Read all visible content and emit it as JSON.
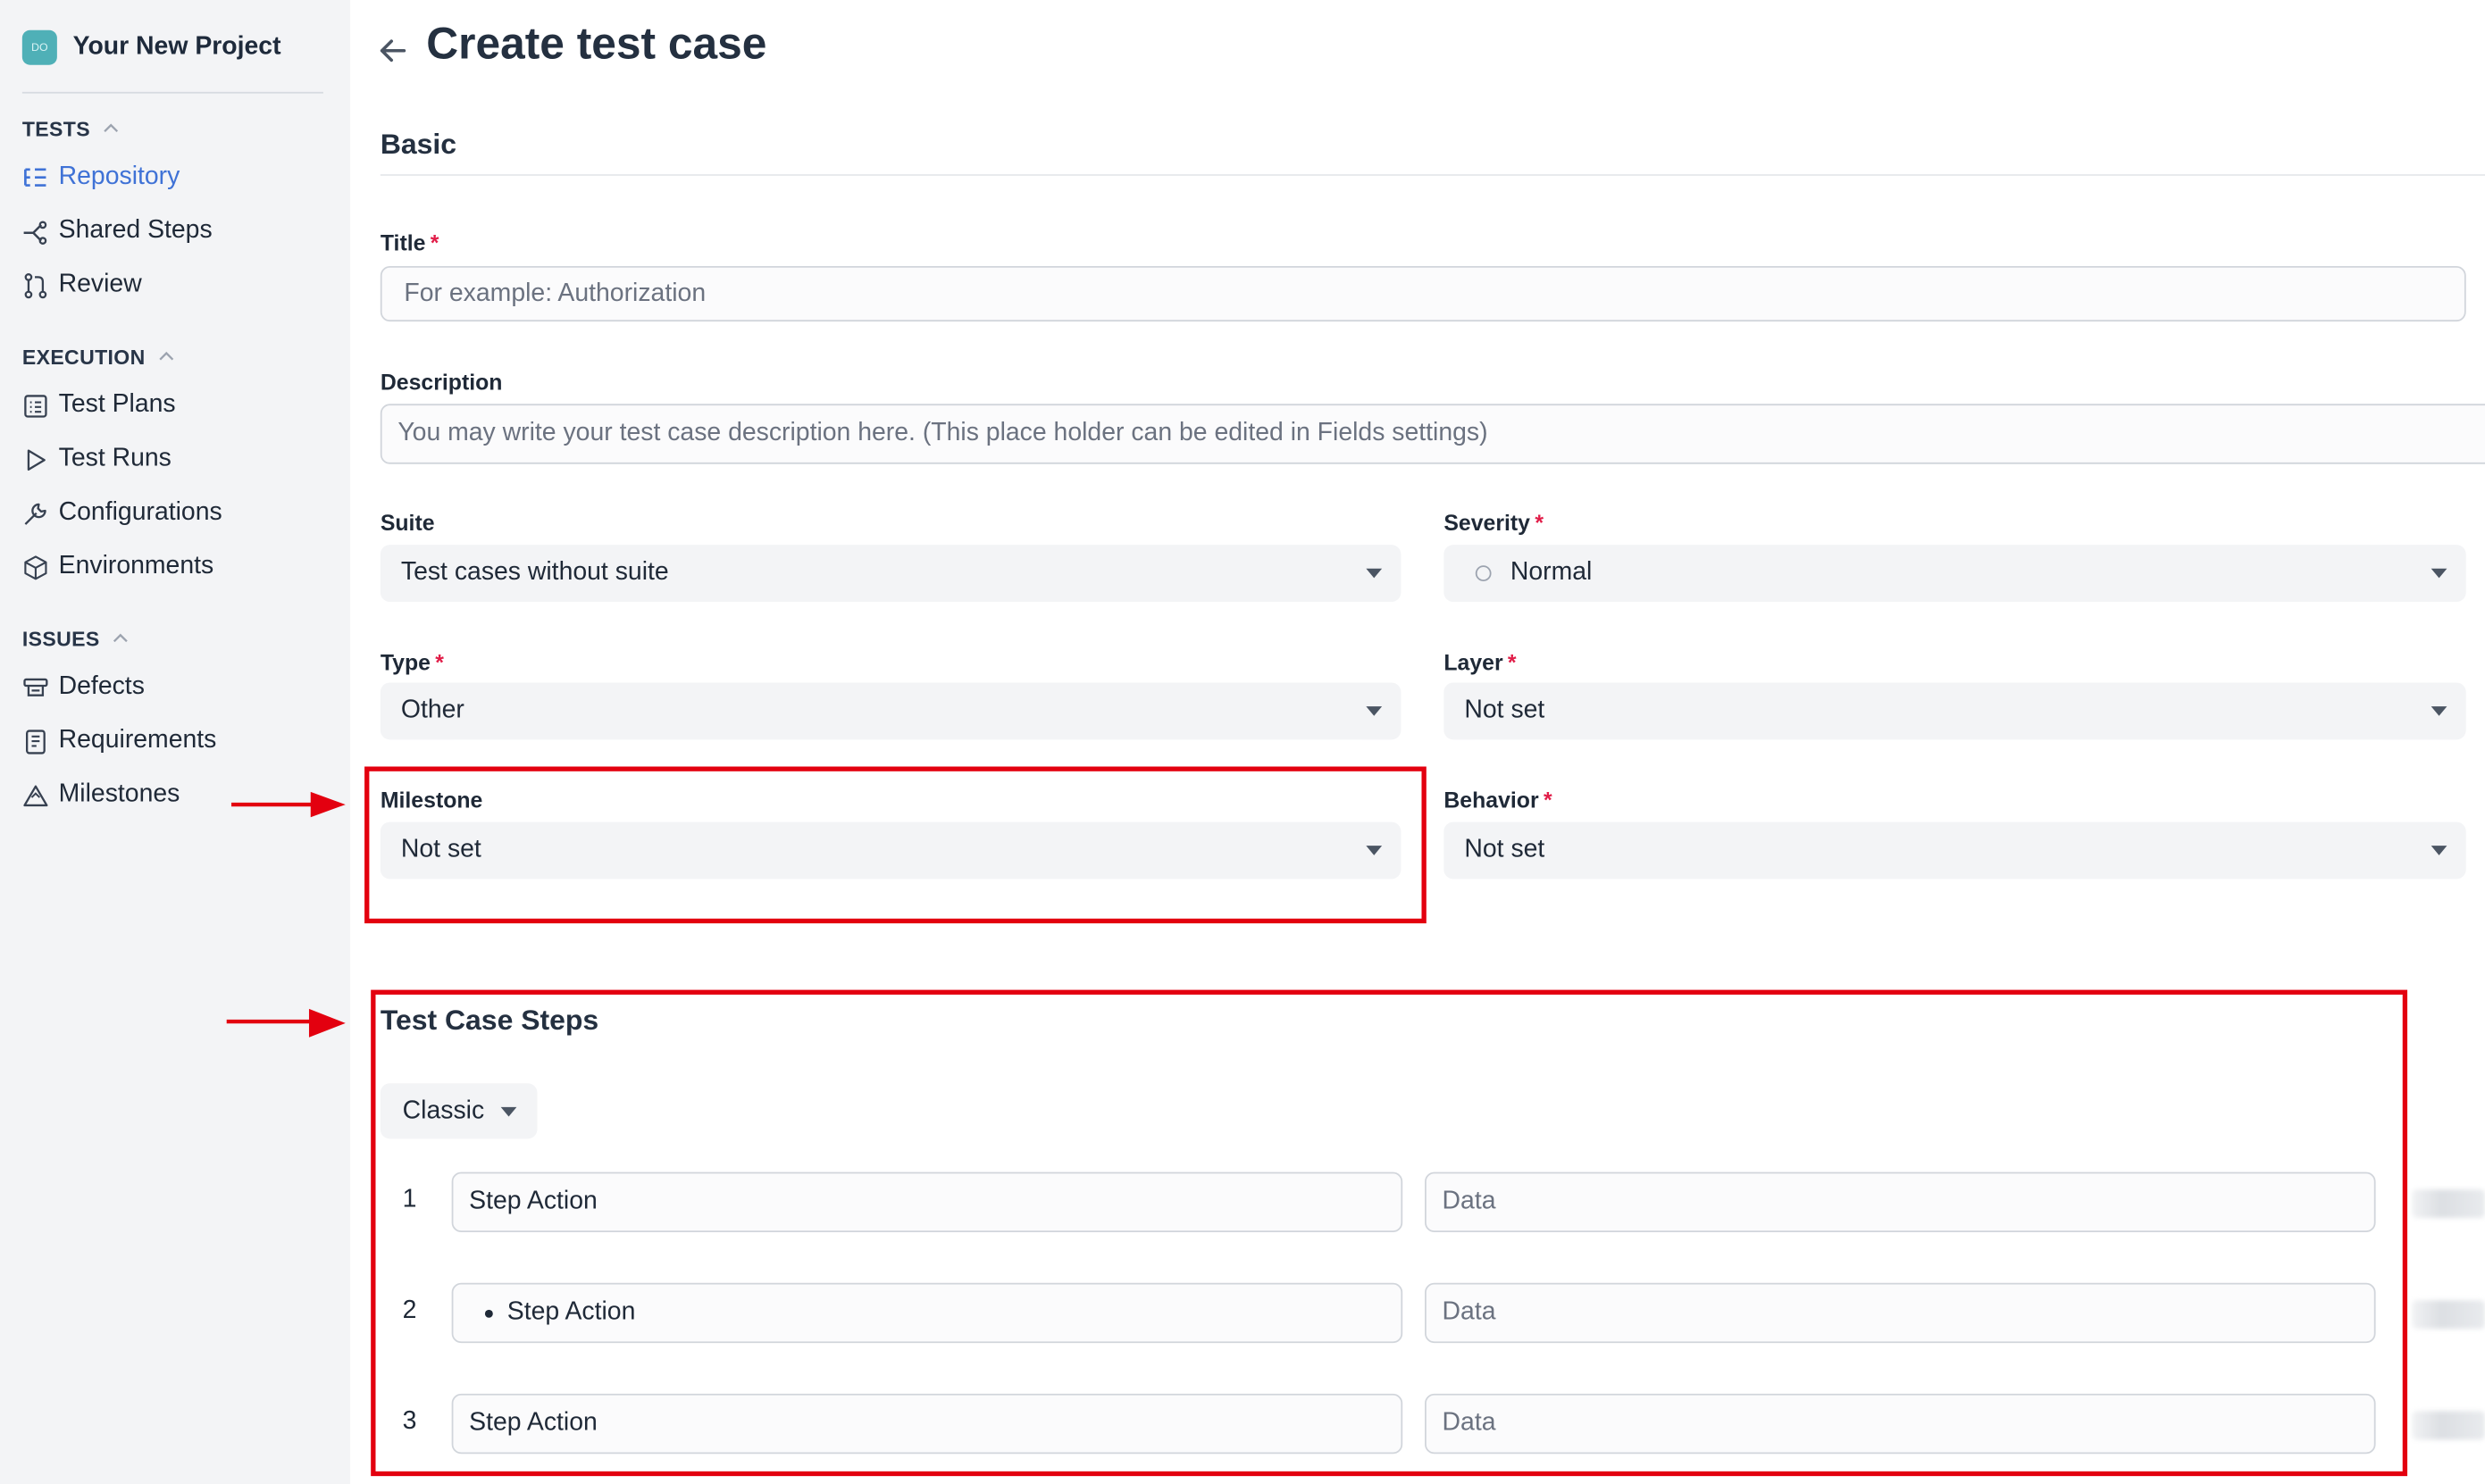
{
  "project": {
    "logo_text": "DO",
    "name": "Your New Project"
  },
  "sidebar": {
    "sections": [
      {
        "title": "TESTS",
        "items": [
          {
            "label": "Repository",
            "icon": "repository-icon",
            "active": true
          },
          {
            "label": "Shared Steps",
            "icon": "shared-steps-icon"
          },
          {
            "label": "Review",
            "icon": "review-icon"
          }
        ]
      },
      {
        "title": "EXECUTION",
        "items": [
          {
            "label": "Test Plans",
            "icon": "test-plans-icon"
          },
          {
            "label": "Test Runs",
            "icon": "play-icon"
          },
          {
            "label": "Configurations",
            "icon": "wrench-icon"
          },
          {
            "label": "Environments",
            "icon": "cube-icon"
          }
        ]
      },
      {
        "title": "ISSUES",
        "items": [
          {
            "label": "Defects",
            "icon": "defects-icon"
          },
          {
            "label": "Requirements",
            "icon": "requirements-icon"
          },
          {
            "label": "Milestones",
            "icon": "milestone-icon"
          }
        ]
      }
    ]
  },
  "page": {
    "title": "Create test case",
    "section_basic": "Basic"
  },
  "form": {
    "title": {
      "label": "Title",
      "placeholder": "For example: Authorization",
      "required": "*"
    },
    "description": {
      "label": "Description",
      "placeholder": "You may write your test case description here. (This place holder can be edited in Fields settings)"
    },
    "suite": {
      "label": "Suite",
      "value": "Test cases without suite"
    },
    "severity": {
      "label": "Severity",
      "value": "Normal",
      "required": "*"
    },
    "type": {
      "label": "Type",
      "value": "Other",
      "required": "*"
    },
    "layer": {
      "label": "Layer",
      "value": "Not set",
      "required": "*"
    },
    "milestone": {
      "label": "Milestone",
      "value": "Not set"
    },
    "behavior": {
      "label": "Behavior",
      "value": "Not set",
      "required": "*"
    }
  },
  "steps": {
    "title": "Test Case Steps",
    "mode": "Classic",
    "rows": [
      {
        "num": "1",
        "action": "Step Action",
        "data": "Data",
        "bulleted": false
      },
      {
        "num": "2",
        "action": "Step Action",
        "data": "Data",
        "bulleted": true
      },
      {
        "num": "3",
        "action": "Step Action",
        "data": "Data",
        "bulleted": false
      }
    ]
  },
  "colors": {
    "accent": "#3f72d6",
    "annotation": "#e3000f",
    "required": "#e11d48"
  }
}
